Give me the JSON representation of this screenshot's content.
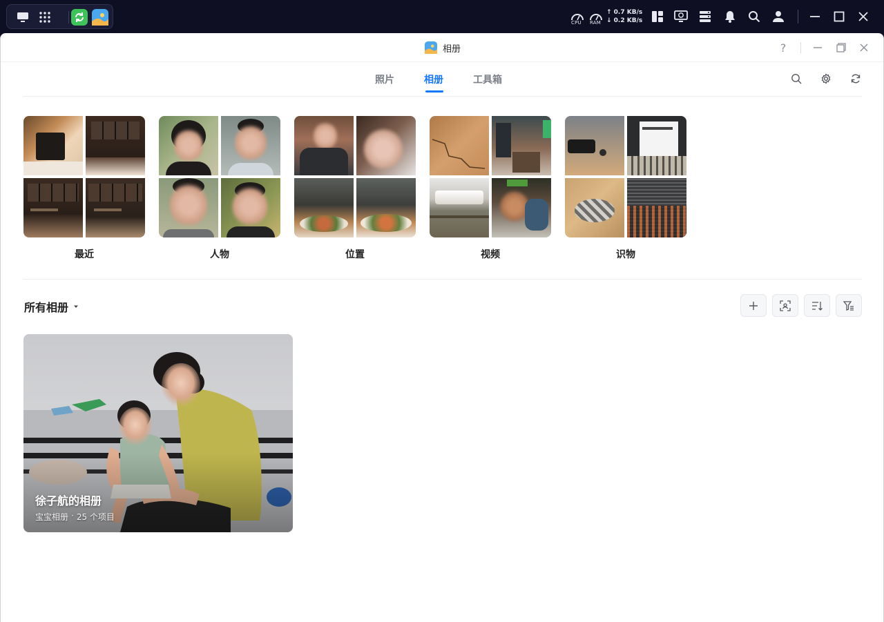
{
  "taskbar": {
    "dock_icons": [
      "desktop-icon",
      "app-grid-icon",
      "sync-app-icon",
      "photos-app-icon"
    ],
    "cpu_label": "CPU",
    "ram_label": "RAM",
    "upload_speed": "↑ 0.7 KB/s",
    "download_speed": "↓ 0.2 KB/s",
    "tray_icons": [
      "widget-icon",
      "monitor-icon",
      "storage-icon",
      "bell-icon",
      "search-icon",
      "user-icon"
    ],
    "window_controls": [
      "minimize-icon",
      "maximize-icon",
      "close-icon"
    ]
  },
  "window": {
    "title": "相册",
    "controls": {
      "help": "?"
    }
  },
  "tabs": [
    {
      "label": "照片",
      "active": false
    },
    {
      "label": "相册",
      "active": true
    },
    {
      "label": "工具箱",
      "active": false
    }
  ],
  "toolbar_icons": [
    "search-icon",
    "settings-icon",
    "refresh-icon"
  ],
  "categories": [
    {
      "label": "最近"
    },
    {
      "label": "人物"
    },
    {
      "label": "位置"
    },
    {
      "label": "视频"
    },
    {
      "label": "识物"
    }
  ],
  "albums_section": {
    "header": "所有相册",
    "action_icons": [
      "add-icon",
      "face-scan-icon",
      "sort-icon",
      "filter-icon"
    ]
  },
  "albums": [
    {
      "name": "徐子航的相册",
      "type": "宝宝相册",
      "separator": "·",
      "count": "25 个项目"
    }
  ],
  "colors": {
    "accent": "#1677ff",
    "taskbar": "#0f0f24"
  }
}
